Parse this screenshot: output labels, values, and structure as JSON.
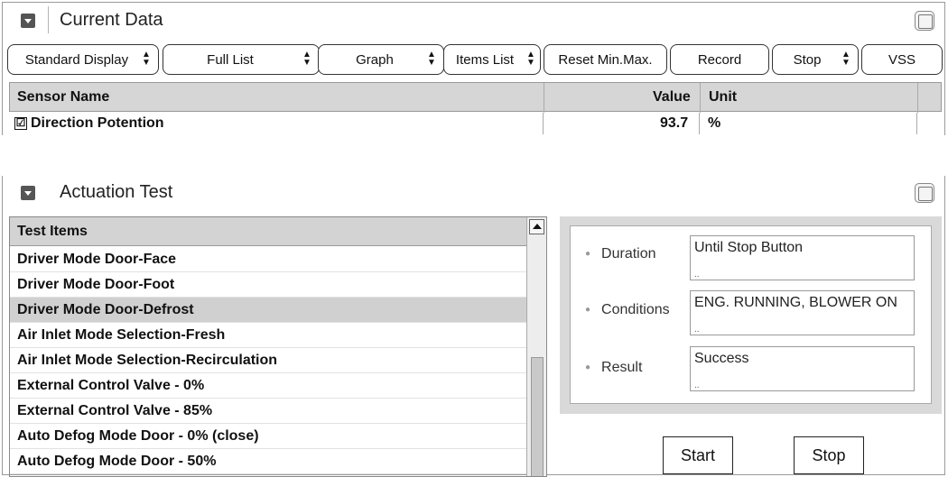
{
  "current_data": {
    "title": "Current Data"
  },
  "toolbar": {
    "standard_display": "Standard Display",
    "full_list": "Full List",
    "graph": "Graph",
    "items_list": "Items List",
    "reset_min_max": "Reset Min.Max.",
    "record": "Record",
    "stop": "Stop",
    "vss": "VSS"
  },
  "sensor_table": {
    "headers": {
      "name": "Sensor Name",
      "value": "Value",
      "unit": "Unit"
    },
    "rows": [
      {
        "checked": "☑",
        "name": "Direction Potention",
        "value": "93.7",
        "unit": "%"
      }
    ]
  },
  "actuation_test": {
    "title": "Actuation Test",
    "list_header": "Test Items",
    "items": [
      "Driver Mode Door-Face",
      "Driver Mode Door-Foot",
      "Driver Mode Door-Defrost",
      "Air Inlet Mode Selection-Fresh",
      "Air Inlet Mode Selection-Recirculation",
      "External Control Valve - 0%",
      "External Control Valve - 85%",
      "Auto Defog Mode Door - 0% (close)",
      "Auto Defog Mode Door - 50%"
    ],
    "selected_item": "Driver Mode Door-Defrost",
    "details": {
      "duration_label": "Duration",
      "duration_value": "Until Stop Button",
      "conditions_label": "Conditions",
      "conditions_value": "ENG. RUNNING, BLOWER ON",
      "result_label": "Result",
      "result_value": "Success"
    },
    "start_label": "Start",
    "stop_label": "Stop"
  },
  "colors": {
    "header_gray": "#d6d6d6",
    "selected_row": "#d0d0d0",
    "detail_frame": "#d9d9d9"
  }
}
